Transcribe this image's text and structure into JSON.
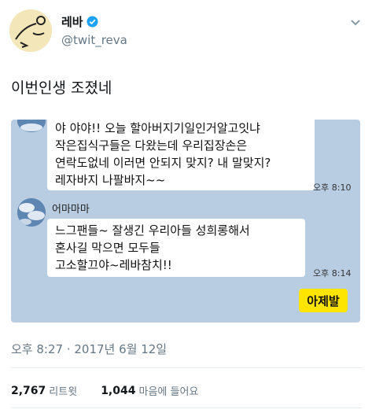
{
  "user": {
    "display_name": "레바",
    "handle": "@twit_reva",
    "verified": true
  },
  "tweet": {
    "text": "이번인생 조졌네",
    "timestamp": "오후 8:27 · 2017년 6월 12일"
  },
  "chat": {
    "messages": [
      {
        "text": "야 야야!! 오늘 할아버지기일인거알고잇냐\n작은집식구들은 다왔는데 우리집장손은\n연락도없네 이러면 안되지 맞지? 내 말맞지?\n레자바지 나팔바지~~",
        "time": "오후 8:10"
      },
      {
        "sender": "어마마마",
        "text": "느그팬들~ 잘생긴 우리아들 성희롱해서\n혼사길 막으면 모두들\n고소할끄야~레바참치!!",
        "time": "오후 8:14"
      }
    ],
    "my_reply": "아제발"
  },
  "stats": {
    "retweets_count": "2,767",
    "retweets_label": "리트윗",
    "likes_count": "1,044",
    "likes_label": "마음에 들어요"
  },
  "colors": {
    "chat_background": "#b8cde1",
    "my_bubble": "#fee500",
    "verified_badge": "#1da1f2",
    "secondary_text": "#657786"
  },
  "icons": {
    "verified": "verified-badge-icon",
    "more": "chevron-down-icon"
  }
}
